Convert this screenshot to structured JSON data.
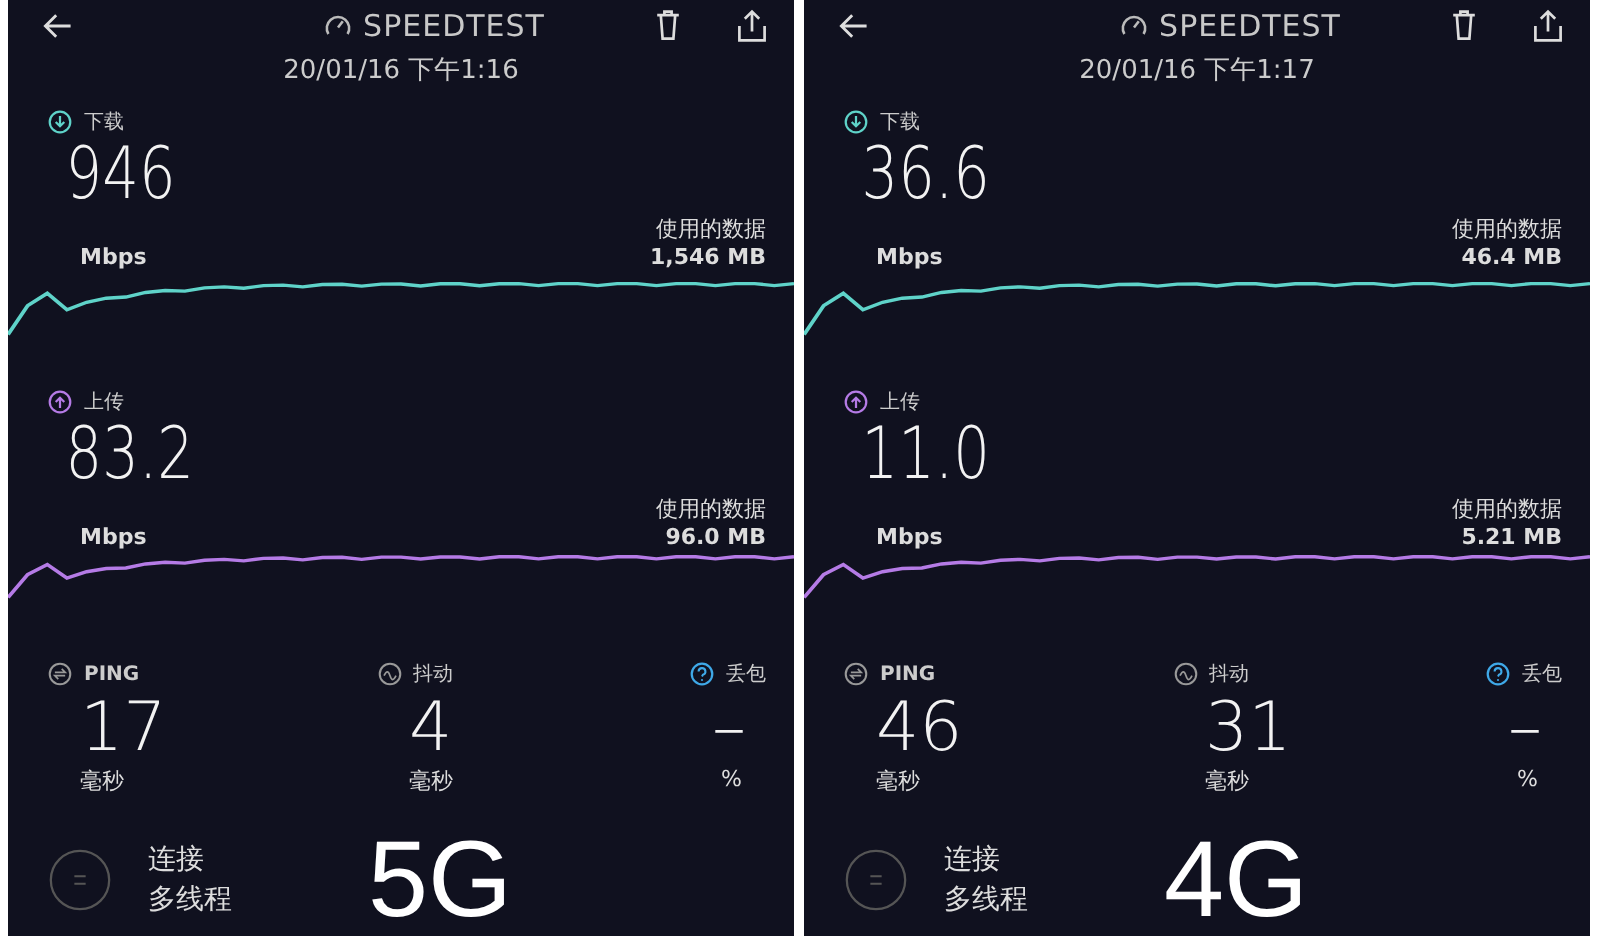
{
  "panels": [
    {
      "app_title": "SPEEDTEST",
      "datetime": "20/01/16 下午1:16",
      "download": {
        "label": "下载",
        "value": "946",
        "unit": "Mbps",
        "data_label": "使用的数据",
        "data_value": "1,546 MB"
      },
      "upload": {
        "label": "上传",
        "value": "83.2",
        "unit": "Mbps",
        "data_label": "使用的数据",
        "data_value": "96.0 MB"
      },
      "stats": [
        {
          "kind": "ping",
          "label": "PING",
          "value": "17",
          "unit": "毫秒"
        },
        {
          "kind": "jitter",
          "label": "抖动",
          "value": "4",
          "unit": "毫秒"
        },
        {
          "kind": "loss",
          "label": "丢包",
          "value": "–",
          "unit": "%"
        }
      ],
      "connection": {
        "line1": "连接",
        "line2": "多线程"
      },
      "network_label": "5G"
    },
    {
      "app_title": "SPEEDTEST",
      "datetime": "20/01/16 下午1:17",
      "download": {
        "label": "下载",
        "value": "36.6",
        "unit": "Mbps",
        "data_label": "使用的数据",
        "data_value": "46.4 MB"
      },
      "upload": {
        "label": "上传",
        "value": "11.0",
        "unit": "Mbps",
        "data_label": "使用的数据",
        "data_value": "5.21 MB"
      },
      "stats": [
        {
          "kind": "ping",
          "label": "PING",
          "value": "46",
          "unit": "毫秒"
        },
        {
          "kind": "jitter",
          "label": "抖动",
          "value": "31",
          "unit": "毫秒"
        },
        {
          "kind": "loss",
          "label": "丢包",
          "value": "–",
          "unit": "%"
        }
      ],
      "connection": {
        "line1": "连接",
        "line2": "多线程"
      },
      "network_label": "4G"
    }
  ]
}
